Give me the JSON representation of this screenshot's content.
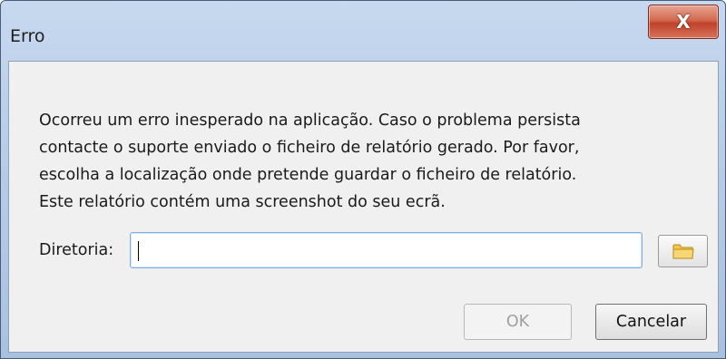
{
  "window": {
    "title": "Erro",
    "close_glyph": "X"
  },
  "message": {
    "lines": [
      "Ocorreu um erro inesperado na aplicação. Caso o problema persista",
      "contacte o suporte enviado o ficheiro de relatório gerado. Por favor,",
      "escolha a localização onde pretende guardar o ficheiro de relatório.",
      "Este relatório contém uma screenshot do seu ecrã."
    ]
  },
  "directory": {
    "label": "Diretoria:",
    "value": "",
    "browse_icon": "folder-icon"
  },
  "buttons": {
    "ok_label": "OK",
    "ok_enabled": false,
    "cancel_label": "Cancelar"
  },
  "colors": {
    "close_button": "#c0432a",
    "dialog_background": "#f0f0f0",
    "folder_icon": "#e8b93c"
  }
}
